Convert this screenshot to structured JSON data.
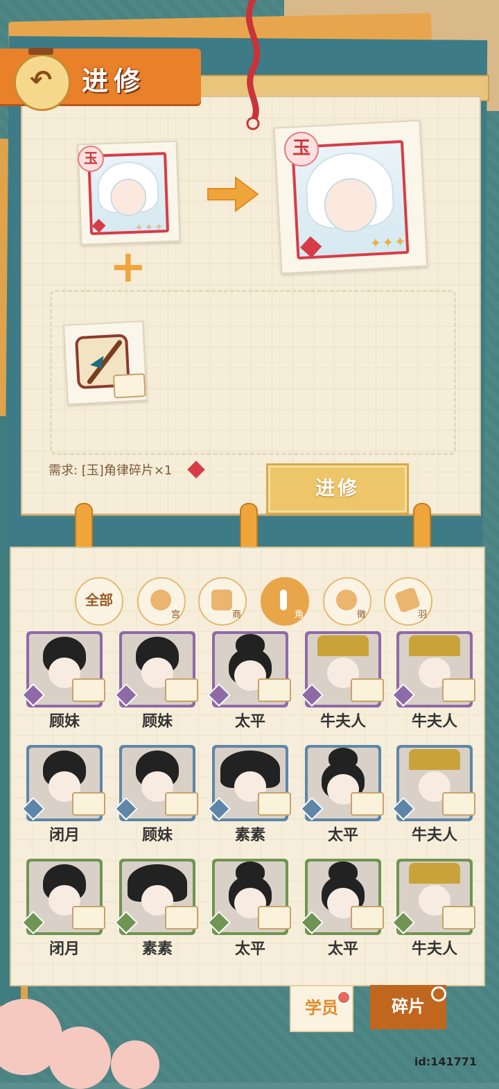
{
  "header": {
    "title": "进修"
  },
  "upgrade": {
    "source_rank_badge": "玉",
    "target_rank_badge": "玉",
    "requirement_text": "需求: [玉]角律碎片×1",
    "advance_button_label": "进修"
  },
  "filters": [
    {
      "label": "全部",
      "icon": "all"
    },
    {
      "label": "宫",
      "icon": "drum-icon"
    },
    {
      "label": "商",
      "icon": "bell-icon"
    },
    {
      "label": "角",
      "icon": "flute-icon",
      "active": true
    },
    {
      "label": "徵",
      "icon": "pipa-icon"
    },
    {
      "label": "羽",
      "icon": "zither-icon"
    }
  ],
  "fragments": [
    {
      "name": "顾妹",
      "frame": "#8e6aa7",
      "style": "bun"
    },
    {
      "name": "顾妹",
      "frame": "#8e6aa7",
      "style": "bun"
    },
    {
      "name": "太平",
      "frame": "#8e6aa7",
      "style": "top"
    },
    {
      "name": "牛夫人",
      "frame": "#8e6aa7",
      "style": "crown"
    },
    {
      "name": "牛夫人",
      "frame": "#8e6aa7",
      "style": "crown"
    },
    {
      "name": "闭月",
      "frame": "#5e86a8",
      "style": "bun"
    },
    {
      "name": "顾妹",
      "frame": "#5e86a8",
      "style": "bun"
    },
    {
      "name": "素素",
      "frame": "#5e86a8",
      "style": "wide"
    },
    {
      "name": "太平",
      "frame": "#5e86a8",
      "style": "top"
    },
    {
      "name": "牛夫人",
      "frame": "#5e86a8",
      "style": "crown"
    },
    {
      "name": "闭月",
      "frame": "#6f9453",
      "style": "bun"
    },
    {
      "name": "素素",
      "frame": "#6f9453",
      "style": "wide"
    },
    {
      "name": "太平",
      "frame": "#6f9453",
      "style": "top"
    },
    {
      "name": "太平",
      "frame": "#6f9453",
      "style": "top"
    },
    {
      "name": "牛夫人",
      "frame": "#6f9453",
      "style": "crown"
    }
  ],
  "bottom_tabs": {
    "student": "学员",
    "fragment": "碎片"
  },
  "user_id": "id:141771",
  "colors": {
    "accent_orange": "#e8812a",
    "jade_red": "#d63c47",
    "button_gold": "#eec66a"
  }
}
